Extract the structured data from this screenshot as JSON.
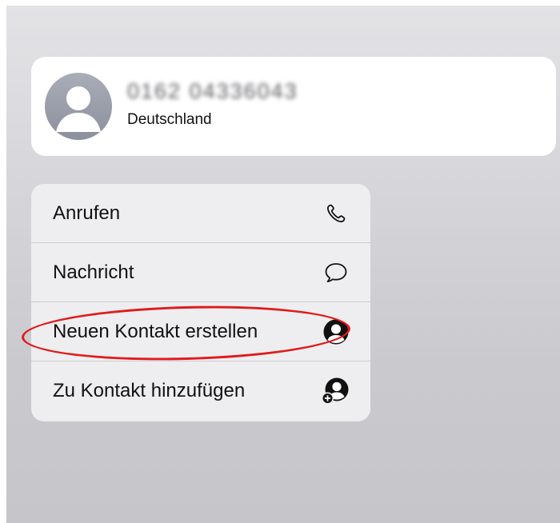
{
  "contact": {
    "number": "0162 04336043",
    "country": "Deutschland"
  },
  "menu": {
    "items": [
      {
        "label": "Anrufen",
        "icon": "phone-icon"
      },
      {
        "label": "Nachricht",
        "icon": "message-bubble-icon"
      },
      {
        "label": "Neuen Kontakt erstellen",
        "icon": "person-circle-icon"
      },
      {
        "label": "Zu Kontakt hinzufügen",
        "icon": "person-circle-plus-icon"
      }
    ]
  },
  "annotation": {
    "highlight_color": "#e01b1b",
    "highlighted_item": "Neuen Kontakt erstellen"
  }
}
